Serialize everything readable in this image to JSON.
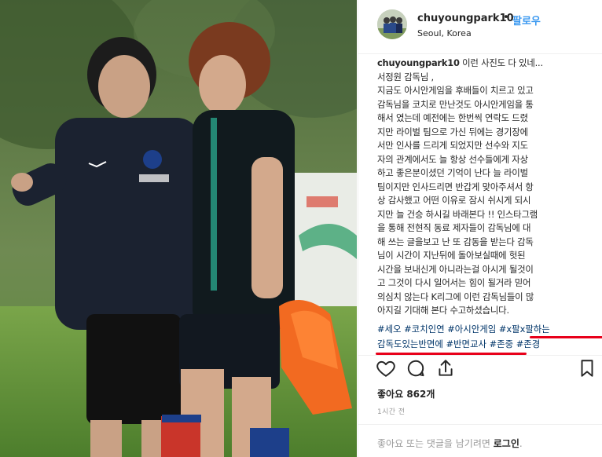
{
  "header": {
    "username": "chuyoungpark10",
    "separator": "•",
    "follow_label": "팔로우",
    "location": "Seoul, Korea"
  },
  "caption": {
    "username": "chuyoungpark10",
    "first_line_text": " 이런 사진도 다 있네...",
    "lines": [
      "서정원 감독님 ,",
      "지금도 아시안게임을 후배들이 치르고 있고",
      "감독님을 코치로 만난것도 아시안게임을 통",
      "해서 였는데 예전에는 한번씩 연락도 드렸",
      "지만 라이벌 팀으로 가신 뒤에는 경기장에",
      "서만 인사를 드리게 되었지만 선수와 지도",
      "자의 관계에서도 늘 항상 선수들에게 자상",
      "하고 좋은분이셨던 기억이 난다 늘 라이벌",
      "팀이지만 인사드리면 반갑게 맞아주셔서 항",
      "상 감사했고 어떤 이유로 잠시 쉬시게 되시",
      "지만 늘 건승 하시길 바래본다 !! 인스타그램",
      "을 통해 전현직 동료 제자들이 감독님에 대",
      "해 쓰는 글을보고 난 또 감동을 받는다 감독",
      "님이 시간이 지난뒤에 돌아보실때에 헛된",
      "시간을 보내신게 아니라는걸 아시게 될것이",
      "고 그것이 다시 일어서는 힘이 될거라 믿어",
      "의심치 않는다 K리그에 이런 감독님들이 많",
      "아지길 기대해 본다 수고하셨습니다."
    ],
    "hashtags_line1": [
      "#세오",
      "#코치인연",
      "#아시안게임",
      "#x팔x팔하는"
    ],
    "hashtags_line2": [
      "감독도있는반면에",
      "#반면교사",
      "#존중",
      "#존경"
    ]
  },
  "stats": {
    "likes_label": "좋아요",
    "likes_count": "862개",
    "time_ago": "1시간 전"
  },
  "comment": {
    "prompt": "좋아요 또는 댓글을 남기려면 ",
    "login_label": "로그인",
    "suffix": "."
  },
  "icons": {
    "like": "heart-icon",
    "comment": "comment-icon",
    "share": "share-icon",
    "save": "bookmark-icon"
  },
  "colors": {
    "link": "#3897f0",
    "hashtag": "#003569",
    "annotation_underline": "#e8001a",
    "text": "#262626",
    "muted": "#999999"
  }
}
